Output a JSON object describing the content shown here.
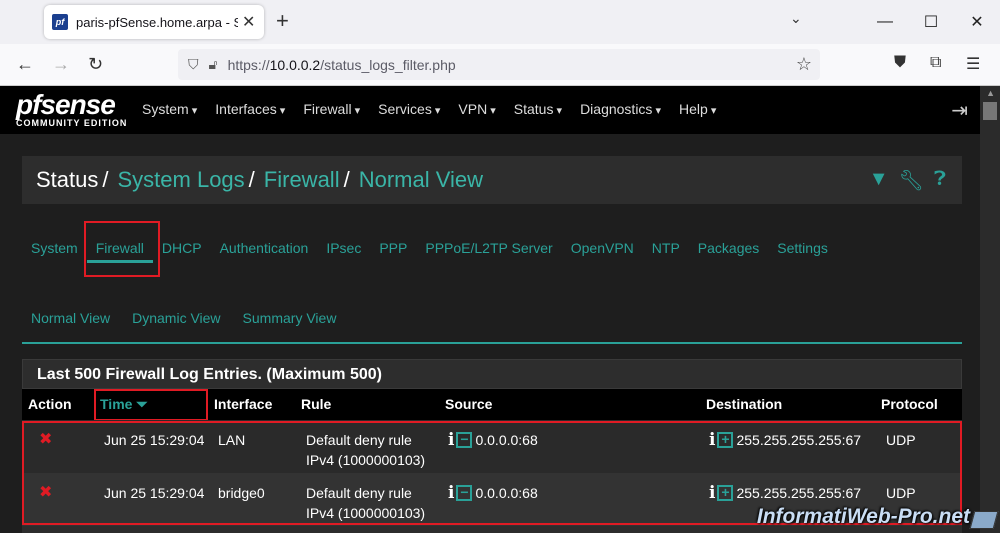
{
  "browser": {
    "tab_title": "paris-pfSense.home.arpa - Statu",
    "url_prefix": "https://",
    "url_host": "10.0.0.2",
    "url_path": "/status_logs_filter.php"
  },
  "pfsense": {
    "logo_main": "pfsense",
    "logo_sub": "COMMUNITY EDITION",
    "menu": [
      "System",
      "Interfaces",
      "Firewall",
      "Services",
      "VPN",
      "Status",
      "Diagnostics",
      "Help"
    ]
  },
  "breadcrumb": {
    "root": "Status",
    "items": [
      "System Logs",
      "Firewall",
      "Normal View"
    ]
  },
  "log_tabs": [
    "System",
    "Firewall",
    "DHCP",
    "Authentication",
    "IPsec",
    "PPP",
    "PPPoE/L2TP Server",
    "OpenVPN",
    "NTP",
    "Packages",
    "Settings"
  ],
  "view_tabs": [
    "Normal View",
    "Dynamic View",
    "Summary View"
  ],
  "panel": {
    "title": "Last 500 Firewall Log Entries. (Maximum 500)",
    "columns": [
      "Action",
      "Time",
      "Interface",
      "Rule",
      "Source",
      "Destination",
      "Protocol"
    ],
    "rows": [
      {
        "time": "Jun 25 15:29:04",
        "interface": "LAN",
        "rule_line1": "Default deny rule",
        "rule_line2": "IPv4 (1000000103)",
        "source": "0.0.0.0:68",
        "destination": "255.255.255.255:67",
        "protocol": "UDP"
      },
      {
        "time": "Jun 25 15:29:04",
        "interface": "bridge0",
        "rule_line1": "Default deny rule",
        "rule_line2": "IPv4 (1000000103)",
        "source": "0.0.0.0:68",
        "destination": "255.255.255.255:67",
        "protocol": "UDP"
      }
    ]
  },
  "watermark": "InformatiWeb-Pro.net",
  "colors": {
    "accent": "#2aa198",
    "highlight": "#e01b24",
    "block": "#e01b24"
  }
}
